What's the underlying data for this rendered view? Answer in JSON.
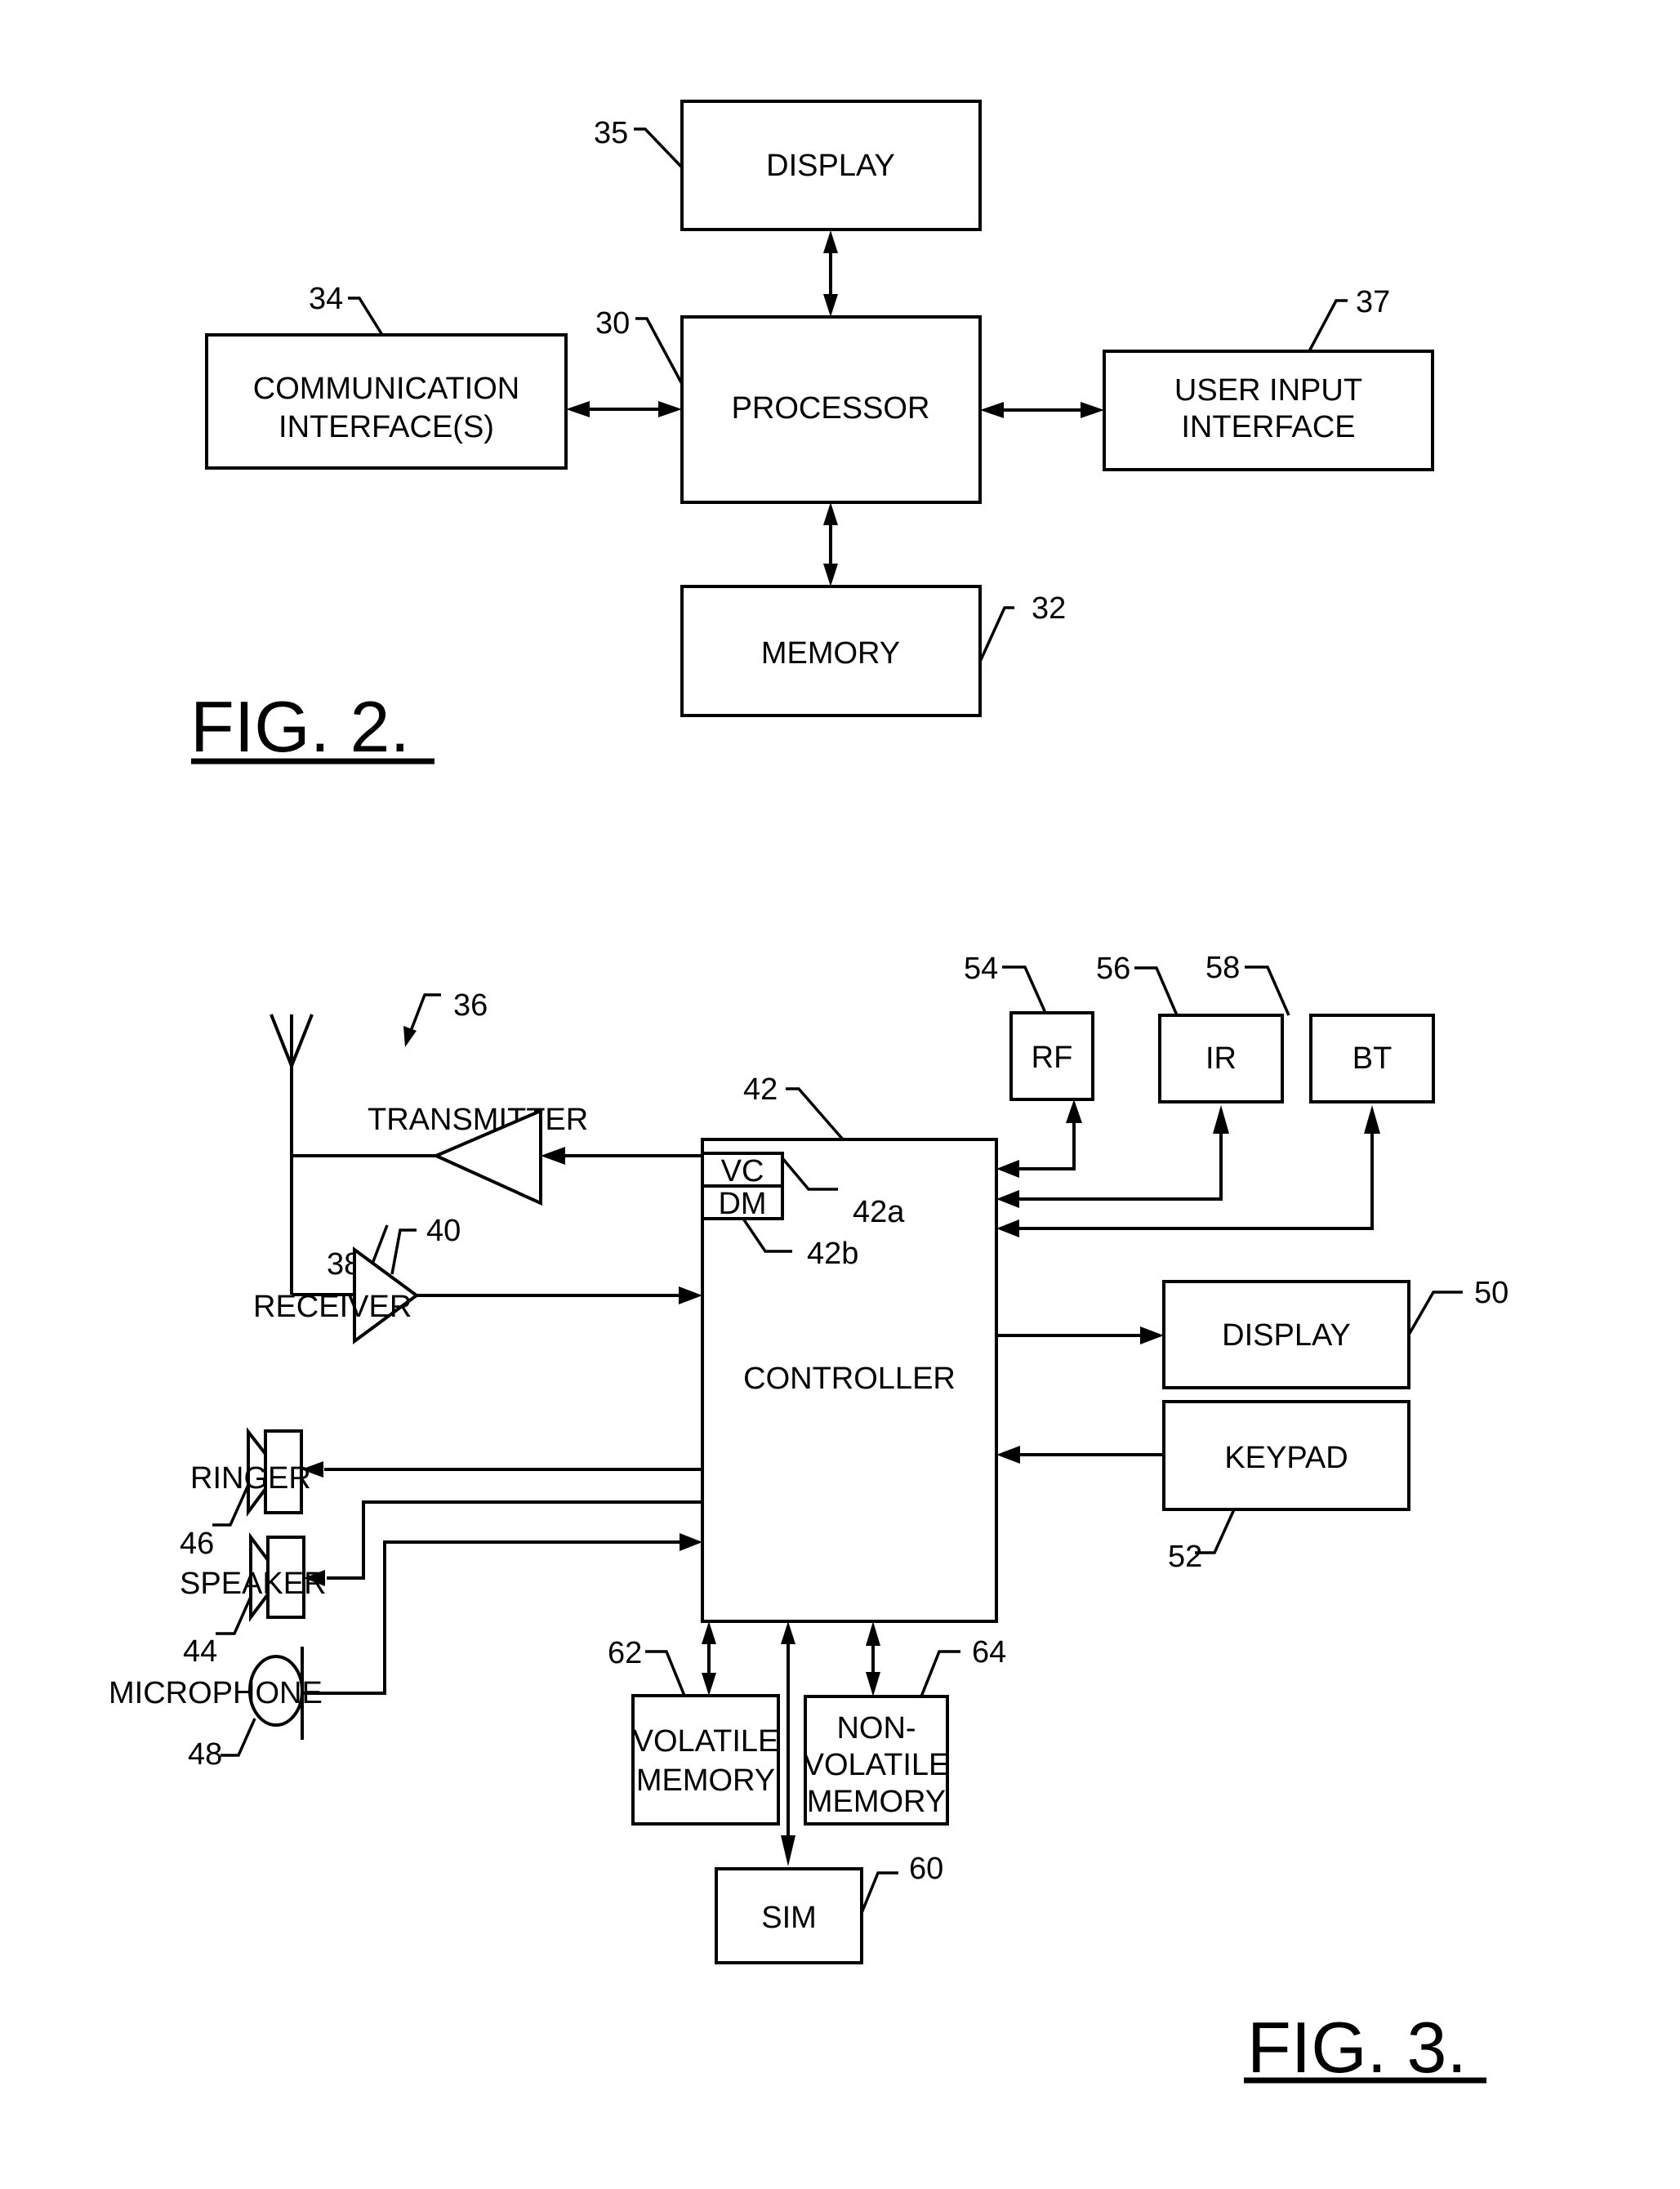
{
  "figure2": {
    "title": "FIG. 2.",
    "blocks": {
      "display": {
        "label": "DISPLAY",
        "ref": "35"
      },
      "processor": {
        "label": "PROCESSOR",
        "ref": "30"
      },
      "communication_interface": {
        "label_line1": "COMMUNICATION",
        "label_line2": "INTERFACE(S)",
        "ref": "34"
      },
      "user_input_interface": {
        "label_line1": "USER INPUT",
        "label_line2": "INTERFACE",
        "ref": "37"
      },
      "memory": {
        "label": "MEMORY",
        "ref": "32"
      }
    },
    "connections": [
      {
        "from": "processor",
        "to": "display",
        "type": "bidirectional"
      },
      {
        "from": "processor",
        "to": "communication_interface",
        "type": "bidirectional"
      },
      {
        "from": "processor",
        "to": "user_input_interface",
        "type": "bidirectional"
      },
      {
        "from": "processor",
        "to": "memory",
        "type": "bidirectional"
      }
    ]
  },
  "figure3": {
    "title": "FIG. 3.",
    "device_ref": "36",
    "blocks": {
      "controller": {
        "label": "CONTROLLER",
        "ref": "42"
      },
      "vc": {
        "label": "VC",
        "ref": "42a"
      },
      "dm": {
        "label": "DM",
        "ref": "42b"
      },
      "transmitter": {
        "label": "TRANSMITTER",
        "ref": "38"
      },
      "receiver": {
        "label": "RECEIVER",
        "ref": "40"
      },
      "rf": {
        "label": "RF",
        "ref": "54"
      },
      "ir": {
        "label": "IR",
        "ref": "56"
      },
      "bt": {
        "label": "BT",
        "ref": "58"
      },
      "display": {
        "label": "DISPLAY",
        "ref": "50"
      },
      "keypad": {
        "label": "KEYPAD",
        "ref": "52"
      },
      "ringer": {
        "label": "RINGER",
        "ref": "46"
      },
      "speaker": {
        "label": "SPEAKER",
        "ref": "44"
      },
      "microphone": {
        "label": "MICROPHONE",
        "ref": "48"
      },
      "volatile_memory": {
        "label_line1": "VOLATILE",
        "label_line2": "MEMORY",
        "ref": "62"
      },
      "non_volatile_memory": {
        "label_line1": "NON-",
        "label_line2": "VOLATILE",
        "label_line3": "MEMORY",
        "ref": "64"
      },
      "sim": {
        "label": "SIM",
        "ref": "60"
      }
    },
    "connections": [
      {
        "from": "controller",
        "to": "transmitter",
        "type": "directed"
      },
      {
        "from": "receiver",
        "to": "controller",
        "type": "directed"
      },
      {
        "from": "controller",
        "to": "rf",
        "type": "bidirectional"
      },
      {
        "from": "controller",
        "to": "ir",
        "type": "bidirectional"
      },
      {
        "from": "controller",
        "to": "bt",
        "type": "bidirectional"
      },
      {
        "from": "controller",
        "to": "display",
        "type": "directed"
      },
      {
        "from": "keypad",
        "to": "controller",
        "type": "directed"
      },
      {
        "from": "controller",
        "to": "ringer",
        "type": "directed"
      },
      {
        "from": "controller",
        "to": "speaker",
        "type": "directed"
      },
      {
        "from": "microphone",
        "to": "controller",
        "type": "directed"
      },
      {
        "from": "controller",
        "to": "volatile_memory",
        "type": "bidirectional"
      },
      {
        "from": "controller",
        "to": "non_volatile_memory",
        "type": "bidirectional"
      },
      {
        "from": "controller",
        "to": "sim",
        "type": "bidirectional"
      }
    ]
  }
}
